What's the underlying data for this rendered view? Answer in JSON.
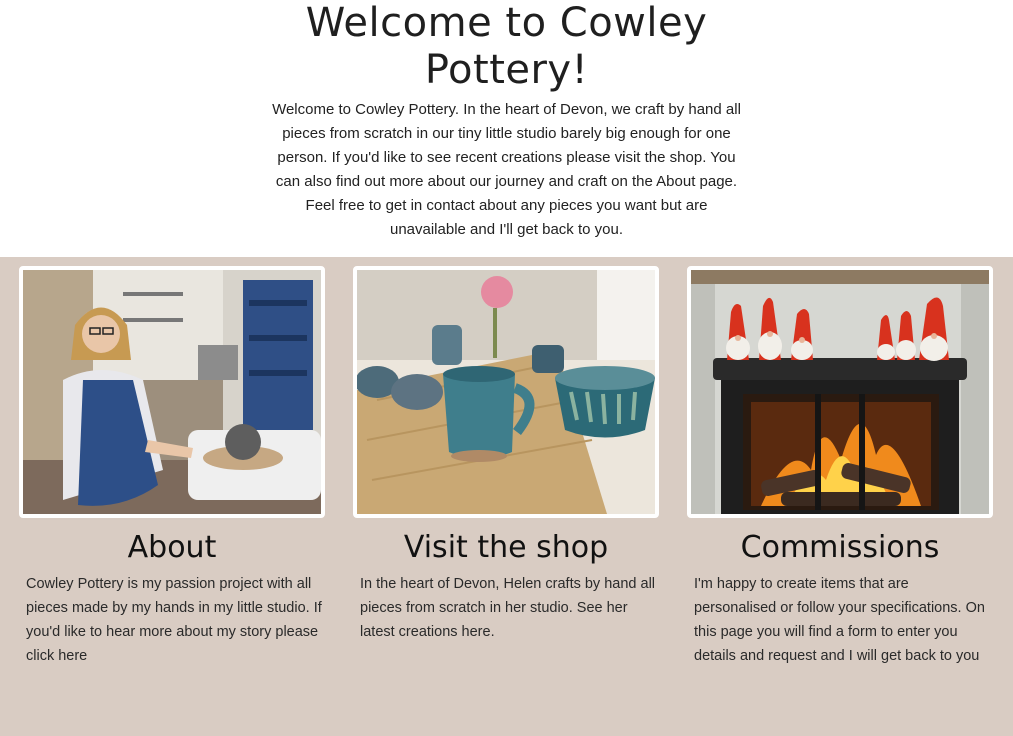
{
  "intro": {
    "title_line1": "Welcome to Cowley",
    "title_line2": "Pottery!",
    "text": "Welcome to Cowley Pottery. In the heart of Devon, we craft by hand all pieces from scratch in our tiny little studio barely big enough for one person. If you'd like to see recent creations please visit the shop. You can also find out more about our journey and craft on the About page. Feel free to get in contact about any pieces you want but are unavailable and I'll get back to you."
  },
  "cards": [
    {
      "title": "About",
      "text": "Cowley Pottery is my passion project with all pieces made by my hands in my little studio. If you'd like to hear more about my story please click here"
    },
    {
      "title": "Visit the shop",
      "text": "In the heart of Devon, Helen crafts by hand all pieces from scratch in her studio. See her latest creations here."
    },
    {
      "title": "Commissions",
      "text": "I'm happy to create items that are personalised or follow your specifications. On this page you will find a form to enter you details and request and I will get back to you"
    }
  ],
  "colors": {
    "page_bg": "#ffffff",
    "cards_bg": "#d9ccc3",
    "photo_border": "#ffffff"
  }
}
